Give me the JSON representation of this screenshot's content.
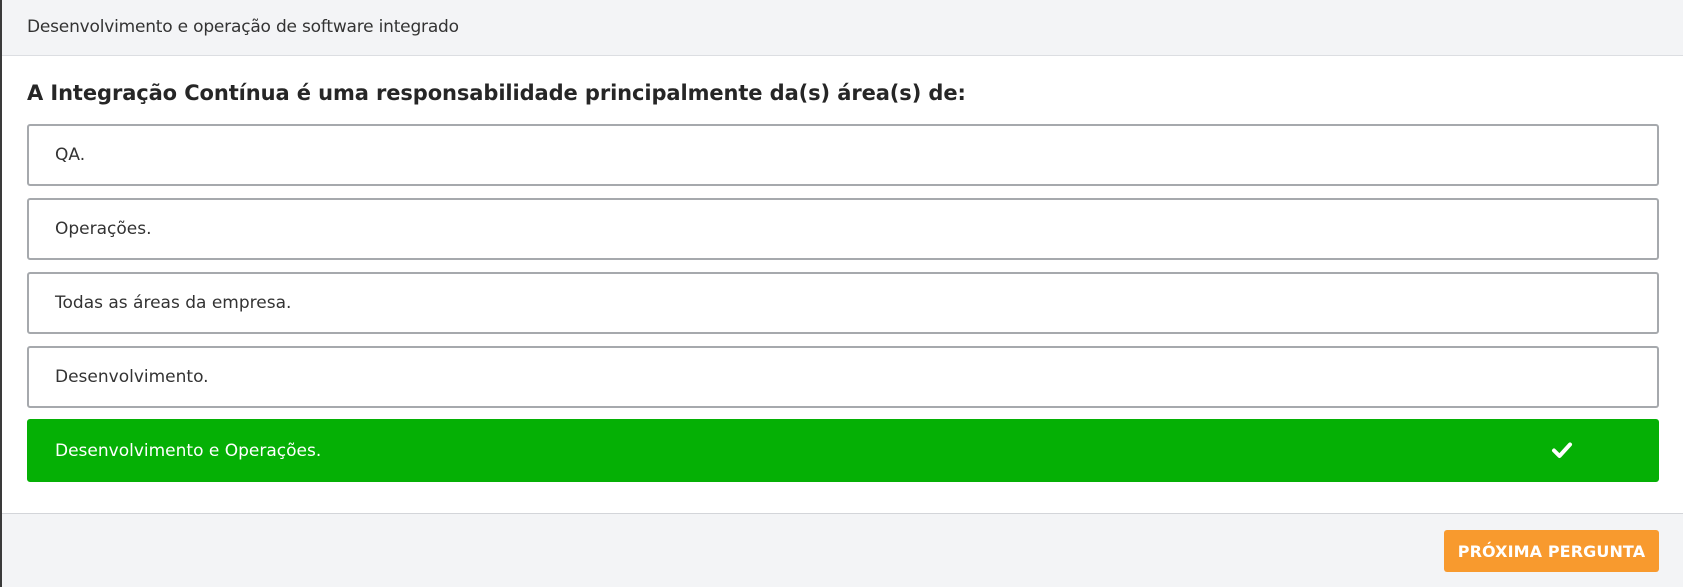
{
  "header": {
    "title": "Desenvolvimento e operação de software integrado"
  },
  "question": {
    "text": "A Integração Contínua é uma responsabilidade principalmente da(s) área(s) de:"
  },
  "options": [
    {
      "label": "QA.",
      "state": "default"
    },
    {
      "label": "Operações.",
      "state": "default"
    },
    {
      "label": "Todas as áreas da empresa.",
      "state": "default"
    },
    {
      "label": "Desenvolvimento.",
      "state": "default"
    },
    {
      "label": "Desenvolvimento e Operações.",
      "state": "correct",
      "icon": "check-icon"
    }
  ],
  "footer": {
    "next_label": "PRÓXIMA PERGUNTA"
  },
  "colors": {
    "correct": "#05b005",
    "accent": "#f89a2e",
    "border": "#a6a9ad",
    "header_bg": "#f3f4f6"
  }
}
